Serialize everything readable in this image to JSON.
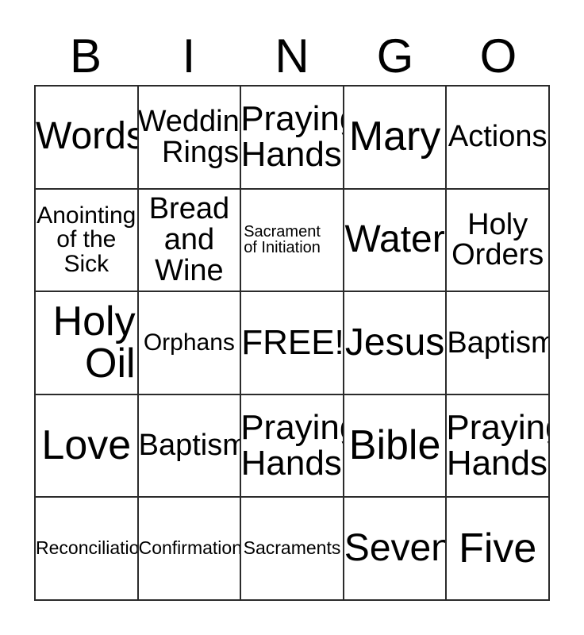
{
  "card": {
    "title_letters": [
      "B",
      "I",
      "N",
      "G",
      "O"
    ],
    "free_space_label": "FREE!",
    "colors": {
      "background": "#ffffff",
      "grid_line": "#2b2b2b",
      "text": "#000000"
    },
    "rows": [
      [
        {
          "label": "Words",
          "size": "xl",
          "align": "center"
        },
        {
          "label": "Wedding\nRings",
          "size": "m",
          "align": "right"
        },
        {
          "label": "Praying\nHands",
          "size": "l",
          "align": "right"
        },
        {
          "label": "Mary",
          "size": "xxl",
          "align": "center"
        },
        {
          "label": "Actions",
          "size": "m",
          "align": "center"
        }
      ],
      [
        {
          "label": "Anointing\nof the\nSick",
          "size": "s",
          "align": "center"
        },
        {
          "label": "Bread\nand\nWine",
          "size": "m",
          "align": "center"
        },
        {
          "label": "Sacrament\nof Initiation",
          "size": "xxs",
          "align": "left"
        },
        {
          "label": "Water",
          "size": "xl",
          "align": "center"
        },
        {
          "label": "Holy\nOrders",
          "size": "m",
          "align": "center"
        }
      ],
      [
        {
          "label": "Holy\nOil",
          "size": "xxl",
          "align": "right"
        },
        {
          "label": "Orphans",
          "size": "s",
          "align": "center"
        },
        {
          "label": "FREE!",
          "size": "l",
          "align": "center"
        },
        {
          "label": "Jesus",
          "size": "xl",
          "align": "center"
        },
        {
          "label": "Baptism",
          "size": "m",
          "align": "center"
        }
      ],
      [
        {
          "label": "Love",
          "size": "xxl",
          "align": "center"
        },
        {
          "label": "Baptism",
          "size": "m",
          "align": "center"
        },
        {
          "label": "Praying\nHands",
          "size": "l",
          "align": "right"
        },
        {
          "label": "Bible",
          "size": "xxl",
          "align": "center"
        },
        {
          "label": "Praying\nHands",
          "size": "l",
          "align": "right"
        }
      ],
      [
        {
          "label": "Reconciliation",
          "size": "xs",
          "align": "center"
        },
        {
          "label": "Confirmation",
          "size": "xs",
          "align": "center"
        },
        {
          "label": "Sacraments",
          "size": "xs",
          "align": "center"
        },
        {
          "label": "Seven",
          "size": "xl",
          "align": "center"
        },
        {
          "label": "Five",
          "size": "xxl",
          "align": "center"
        }
      ]
    ]
  }
}
